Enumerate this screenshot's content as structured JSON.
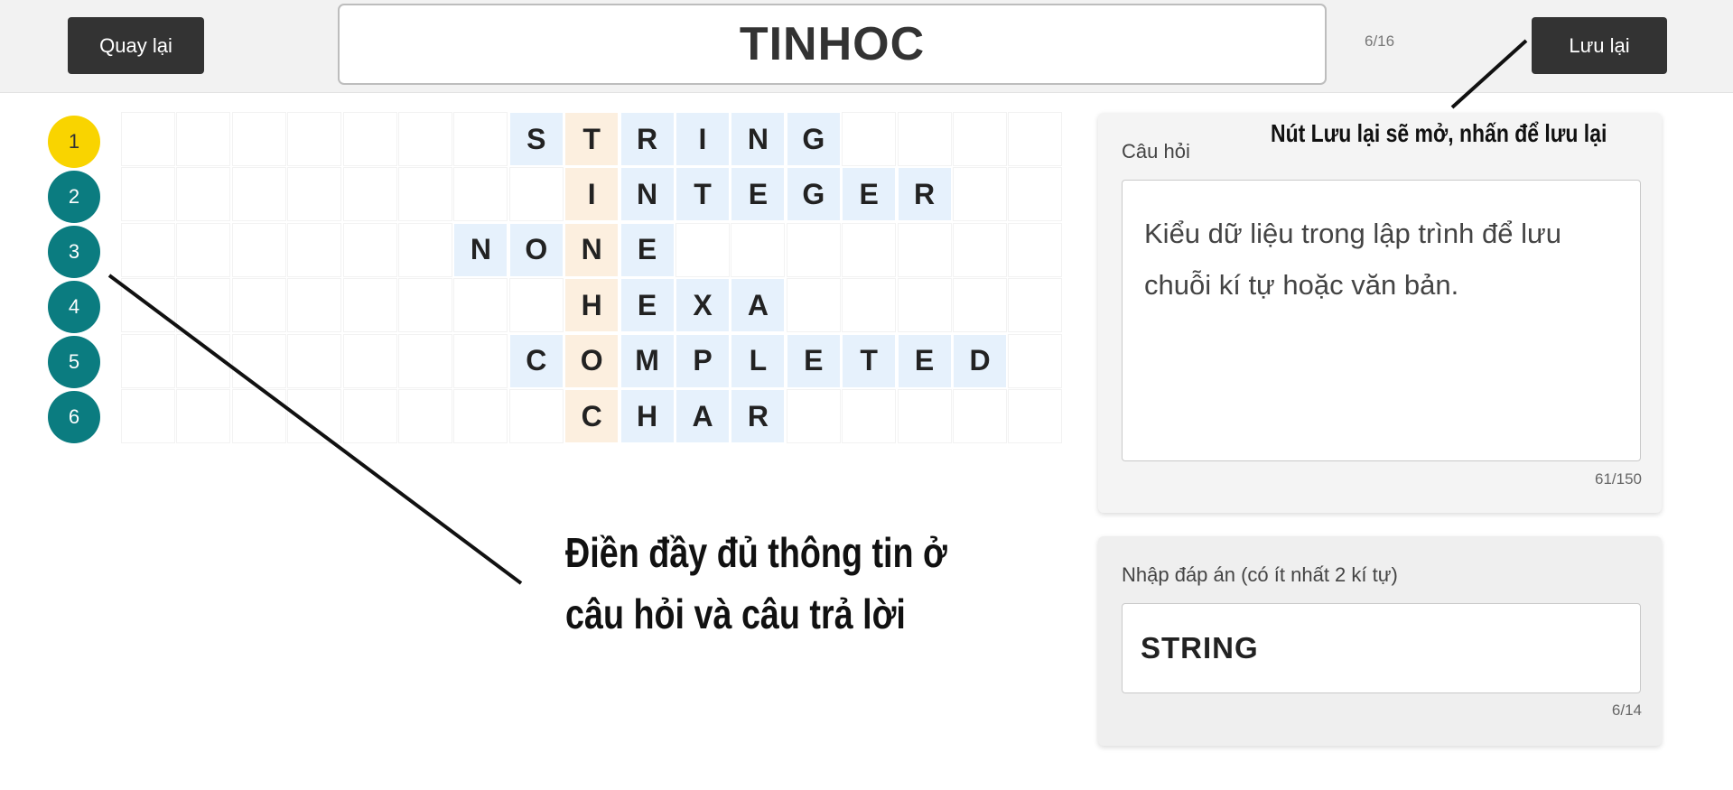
{
  "header": {
    "back_label": "Quay lại",
    "title": "TINHOC",
    "progress": "6/16",
    "save_label": "Lưu lại"
  },
  "questions": [
    {
      "num": "1",
      "active": true
    },
    {
      "num": "2",
      "active": false
    },
    {
      "num": "3",
      "active": false
    },
    {
      "num": "4",
      "active": false
    },
    {
      "num": "5",
      "active": false
    },
    {
      "num": "6",
      "active": false
    }
  ],
  "crossword": {
    "columns": 17,
    "rows": [
      {
        "word": "STRING",
        "start": 7
      },
      {
        "word": "INTEGER",
        "start": 8
      },
      {
        "word": "NONE",
        "start": 6
      },
      {
        "word": "HEXA",
        "start": 8
      },
      {
        "word": "COMPLETED",
        "start": 7
      },
      {
        "word": "CHAR",
        "start": 8
      }
    ],
    "key_column": 8
  },
  "question_panel": {
    "label": "Câu hỏi",
    "text": "Kiểu dữ liệu trong lập trình để lưu chuỗi kí tự hoặc văn bản.",
    "char_count": "61/150"
  },
  "answer_panel": {
    "label": "Nhập đáp án (có ít nhất 2 kí tự)",
    "value": "STRING",
    "char_count": "6/14"
  },
  "annotations": {
    "fill_hint": "Điền đầy đủ thông tin ở câu hỏi và câu trả lời",
    "save_hint": "Nút Lưu lại sẽ mở, nhấn để lưu lại"
  },
  "colors": {
    "dark_button": "#333333",
    "circle": "#0b7c80",
    "circle_active": "#f9d400",
    "word_cell": "#e6f1fc",
    "key_cell": "#fcefdf"
  }
}
